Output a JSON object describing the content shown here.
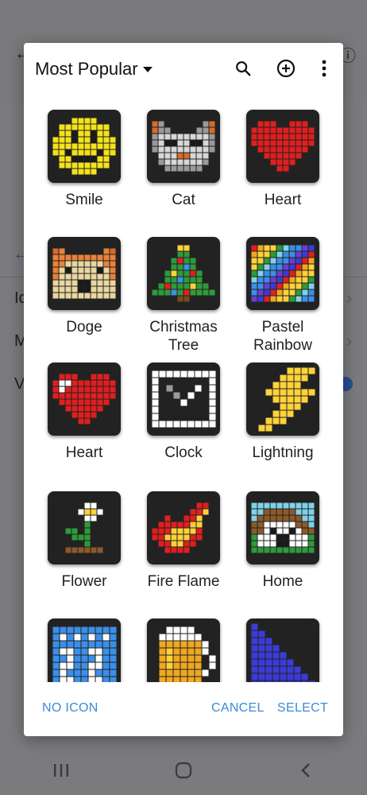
{
  "dialog": {
    "title": "Most Popular",
    "tiles": [
      {
        "label": "Smile",
        "icon": "smile-pixel-icon"
      },
      {
        "label": "Cat",
        "icon": "cat-pixel-icon"
      },
      {
        "label": "Heart",
        "icon": "red-heart-pixel-icon"
      },
      {
        "label": "Doge",
        "icon": "doge-pixel-icon"
      },
      {
        "label": "Christmas\nTree",
        "icon": "christmas-tree-pixel-icon"
      },
      {
        "label": "Pastel\nRainbow",
        "icon": "pastel-rainbow-pixel-icon"
      },
      {
        "label": "Heart",
        "icon": "heart-pixel-icon"
      },
      {
        "label": "Clock",
        "icon": "clock-pixel-icon"
      },
      {
        "label": "Lightning",
        "icon": "lightning-pixel-icon"
      },
      {
        "label": "Flower",
        "icon": "flower-pixel-icon"
      },
      {
        "label": "Fire Flame",
        "icon": "fire-flame-pixel-icon"
      },
      {
        "label": "Home",
        "icon": "home-pixel-icon"
      },
      {
        "label": "",
        "icon": "calendar-pixel-icon"
      },
      {
        "label": "",
        "icon": "beer-pixel-icon"
      },
      {
        "label": "",
        "icon": "triangle-pixel-icon"
      }
    ],
    "footer": {
      "no_icon": "NO ICON",
      "cancel": "CANCEL",
      "select": "SELECT"
    }
  },
  "background": {
    "rows": [
      "Ic",
      "M",
      "V"
    ]
  },
  "colors": {
    "accent": "#3d8ad6",
    "tile_bg": "#222222"
  }
}
